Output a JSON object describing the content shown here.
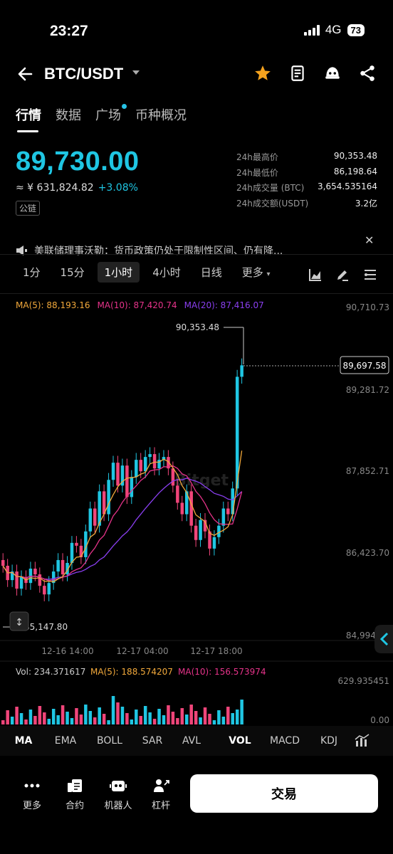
{
  "status": {
    "time": "23:27",
    "network": "4G",
    "battery": "73"
  },
  "header": {
    "pair": "BTC/USDT"
  },
  "tabs": [
    "行情",
    "数据",
    "广场",
    "币种概况"
  ],
  "ticker": {
    "price": "89,730.00",
    "cny": "≈ ¥ 631,824.82",
    "change": "+3.08%",
    "chain_badge": "公链",
    "stats": [
      {
        "k": "24h最高价",
        "v": "90,353.48"
      },
      {
        "k": "24h最低价",
        "v": "86,198.64"
      },
      {
        "k": "24h成交量 (BTC)",
        "v": "3,654.535164"
      },
      {
        "k": "24h成交额(USDT)",
        "v": "3.2亿"
      }
    ]
  },
  "notice": {
    "text": "美联储理事沃勒：货币政策仍处于限制性区间、仍有降..."
  },
  "intervals": [
    "1分",
    "15分",
    "1小时",
    "4小时",
    "日线",
    "更多"
  ],
  "ma_legend": {
    "ma5": "MA(5): 88,193.16",
    "ma10": "MA(10): 87,420.74",
    "ma20": "MA(20): 87,416.07"
  },
  "chart_data": {
    "type": "candlestick",
    "price_axis_labels": [
      "90,710.73",
      "89,281.72",
      "87,852.71",
      "86,423.70",
      "84,994.70"
    ],
    "time_axis_labels": [
      "12-16 14:00",
      "12-17 04:00",
      "12-17 18:00"
    ],
    "current_price_label": "89,697.58",
    "high_marker": "90,353.48",
    "low_marker": "85,147.80",
    "watermark": "Bitget",
    "volume_legend": {
      "vol": "Vol: 234.371617",
      "ma5": "MA(5): 188.574207",
      "ma10": "MA(10): 156.573974"
    },
    "volume_axis_labels": [
      "629.935451",
      "0.00"
    ],
    "colors": {
      "up": "#1fc6e3",
      "down": "#f0457a",
      "ma5": "#f2a93b",
      "ma10": "#e6338a",
      "ma20": "#8a3ff0"
    }
  },
  "indicators": [
    "MA",
    "EMA",
    "BOLL",
    "SAR",
    "AVL",
    "VOL",
    "MACD",
    "KDJ"
  ],
  "bottom_nav": [
    "更多",
    "合约",
    "机器人",
    "杠杆"
  ],
  "trade_button": "交易"
}
